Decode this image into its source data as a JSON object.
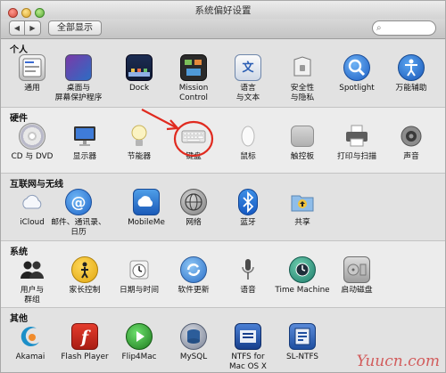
{
  "window": {
    "title": "系统偏好设置"
  },
  "toolbar": {
    "back": "◀",
    "forward": "▶",
    "show_all": "全部显示"
  },
  "sections": [
    {
      "title": "个人",
      "items": [
        {
          "label": "通用",
          "icon": "general-icon"
        },
        {
          "label": "桌面与\n屏幕保护程序",
          "icon": "desktop-icon"
        },
        {
          "label": "Dock",
          "icon": "dock-icon"
        },
        {
          "label": "Mission\nControl",
          "icon": "mission-control-icon"
        },
        {
          "label": "语言\n与文本",
          "icon": "language-icon"
        },
        {
          "label": "安全性\n与隐私",
          "icon": "security-icon"
        },
        {
          "label": "Spotlight",
          "icon": "spotlight-icon"
        },
        {
          "label": "万能辅助",
          "icon": "accessibility-icon"
        }
      ]
    },
    {
      "title": "硬件",
      "items": [
        {
          "label": "CD 与 DVD",
          "icon": "cd-dvd-icon"
        },
        {
          "label": "显示器",
          "icon": "display-icon"
        },
        {
          "label": "节能器",
          "icon": "energy-saver-icon"
        },
        {
          "label": "键盘",
          "icon": "keyboard-icon"
        },
        {
          "label": "鼠标",
          "icon": "mouse-icon"
        },
        {
          "label": "触控板",
          "icon": "trackpad-icon"
        },
        {
          "label": "打印与扫描",
          "icon": "printer-icon"
        },
        {
          "label": "声音",
          "icon": "sound-icon"
        }
      ]
    },
    {
      "title": "互联网与无线",
      "items": [
        {
          "label": "iCloud",
          "icon": "icloud-icon"
        },
        {
          "label": "邮件、通讯录、\n日历",
          "icon": "mail-icon"
        },
        {
          "label": "MobileMe",
          "icon": "mobileme-icon"
        },
        {
          "label": "网络",
          "icon": "network-icon"
        },
        {
          "label": "蓝牙",
          "icon": "bluetooth-icon"
        },
        {
          "label": "共享",
          "icon": "sharing-icon"
        }
      ]
    },
    {
      "title": "系统",
      "items": [
        {
          "label": "用户与\n群组",
          "icon": "users-icon"
        },
        {
          "label": "家长控制",
          "icon": "parental-controls-icon"
        },
        {
          "label": "日期与时间",
          "icon": "date-time-icon"
        },
        {
          "label": "软件更新",
          "icon": "software-update-icon"
        },
        {
          "label": "语音",
          "icon": "speech-icon"
        },
        {
          "label": "Time Machine",
          "icon": "time-machine-icon"
        },
        {
          "label": "启动磁盘",
          "icon": "startup-disk-icon"
        }
      ]
    },
    {
      "title": "其他",
      "items": [
        {
          "label": "Akamai",
          "icon": "akamai-icon"
        },
        {
          "label": "Flash Player",
          "icon": "flash-player-icon"
        },
        {
          "label": "Flip4Mac",
          "icon": "flip4mac-icon"
        },
        {
          "label": "MySQL",
          "icon": "mysql-icon"
        },
        {
          "label": "NTFS for\nMac OS X",
          "icon": "ntfs-icon"
        },
        {
          "label": "SL-NTFS",
          "icon": "sl-ntfs-icon"
        }
      ]
    }
  ],
  "watermark": "Yuucn.com"
}
